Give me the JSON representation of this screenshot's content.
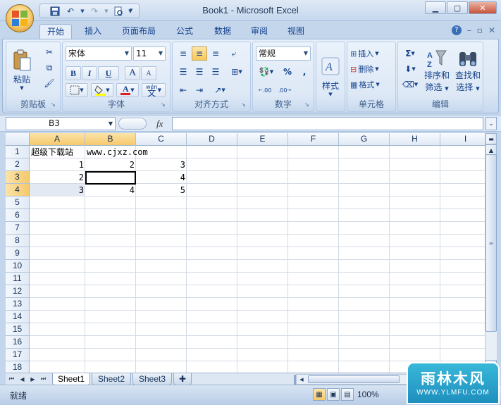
{
  "window": {
    "title": "Book1 - Microsoft Excel"
  },
  "ribbon_tabs": [
    "开始",
    "插入",
    "页面布局",
    "公式",
    "数据",
    "审阅",
    "视图"
  ],
  "clipboard": {
    "paste_label": "粘贴",
    "group_label": "剪贴板"
  },
  "font": {
    "name": "宋体",
    "size": "11",
    "group_label": "字体",
    "bold": "B",
    "italic": "I",
    "underline": "U",
    "grow": "A",
    "shrink": "A",
    "color_letter": "A",
    "phonetic": "wén",
    "phonetic_char": "文"
  },
  "alignment": {
    "group_label": "对齐方式"
  },
  "number": {
    "format": "常规",
    "group_label": "数字",
    "percent": "%",
    "comma": ",",
    "inc_decimal": ".00",
    "dec_decimal": ".00"
  },
  "styles": {
    "label": "样式"
  },
  "cells": {
    "insert": "插入",
    "delete": "删除",
    "format": "格式",
    "group_label": "单元格"
  },
  "editing": {
    "sum": "Σ",
    "sort_label": "排序和",
    "sort_label2": "筛选",
    "find_label": "查找和",
    "find_label2": "选择",
    "group_label": "编辑"
  },
  "formula_bar": {
    "name_box": "B3",
    "fx": "fx",
    "value": ""
  },
  "columns": [
    "A",
    "B",
    "C",
    "D",
    "E",
    "F",
    "G",
    "H",
    "I"
  ],
  "rows": [
    "1",
    "2",
    "3",
    "4",
    "5",
    "6",
    "7",
    "8",
    "9",
    "10",
    "11",
    "12",
    "13",
    "14",
    "15",
    "16",
    "17",
    "18"
  ],
  "cells_data": {
    "A1": "超级下载站",
    "B1": "www.cjxz.com",
    "A2": "1",
    "B2": "2",
    "C2": "3",
    "A3": "2",
    "C3": "4",
    "A4": "3",
    "B4": "4",
    "C4": "5"
  },
  "sheets": [
    "Sheet1",
    "Sheet2",
    "Sheet3"
  ],
  "status": {
    "ready": "就绪",
    "zoom": "100%"
  },
  "watermark": {
    "text": "雨林木风",
    "url": "WWW.YLMFU.COM"
  }
}
